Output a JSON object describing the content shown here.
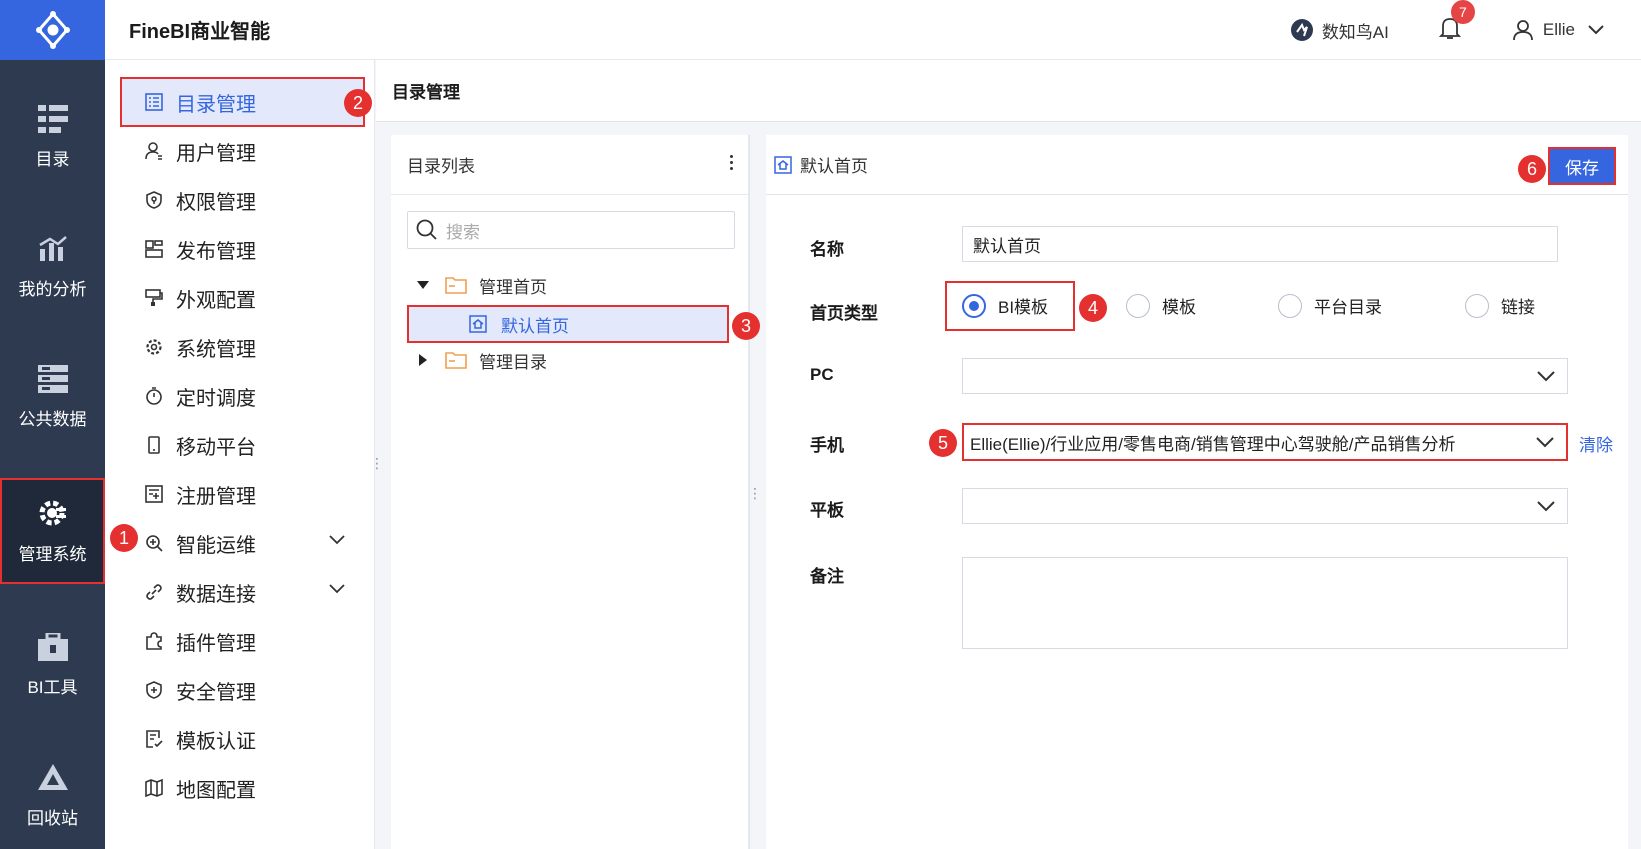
{
  "app": {
    "title": "FineBI商业智能"
  },
  "header": {
    "ai_label": "数知鸟AI",
    "notification_count": "7",
    "user_name": "Ellie"
  },
  "rail": {
    "items": [
      {
        "label": "目录",
        "icon": "catalog-icon"
      },
      {
        "label": "我的分析",
        "icon": "analysis-icon"
      },
      {
        "label": "公共数据",
        "icon": "public-data-icon"
      },
      {
        "label": "管理系统",
        "icon": "gear-icon",
        "active": true
      },
      {
        "label": "BI工具",
        "icon": "toolbox-icon"
      },
      {
        "label": "回收站",
        "icon": "recycle-icon"
      }
    ]
  },
  "submenu": {
    "items": [
      {
        "label": "目录管理",
        "icon": "list-icon",
        "active": true
      },
      {
        "label": "用户管理",
        "icon": "user-icon"
      },
      {
        "label": "权限管理",
        "icon": "permission-icon"
      },
      {
        "label": "发布管理",
        "icon": "publish-icon"
      },
      {
        "label": "外观配置",
        "icon": "appearance-icon"
      },
      {
        "label": "系统管理",
        "icon": "settings-icon"
      },
      {
        "label": "定时调度",
        "icon": "timer-icon"
      },
      {
        "label": "移动平台",
        "icon": "mobile-icon"
      },
      {
        "label": "注册管理",
        "icon": "register-icon"
      },
      {
        "label": "智能运维",
        "icon": "ops-icon",
        "expandable": true
      },
      {
        "label": "数据连接",
        "icon": "link-icon",
        "expandable": true
      },
      {
        "label": "插件管理",
        "icon": "plugin-icon"
      },
      {
        "label": "安全管理",
        "icon": "shield-icon"
      },
      {
        "label": "模板认证",
        "icon": "template-auth-icon"
      },
      {
        "label": "地图配置",
        "icon": "map-icon"
      }
    ]
  },
  "content": {
    "title": "目录管理"
  },
  "directory": {
    "title": "目录列表",
    "search_placeholder": "搜索",
    "tree": [
      {
        "label": "管理首页",
        "expanded": true
      },
      {
        "label": "默认首页",
        "selected": true
      },
      {
        "label": "管理目录",
        "expanded": false
      }
    ]
  },
  "detail": {
    "title": "默认首页",
    "save_label": "保存",
    "fields": {
      "name_label": "名称",
      "name_value": "默认首页",
      "type_label": "首页类型",
      "type_options": [
        "BI模板",
        "模板",
        "平台目录",
        "链接"
      ],
      "type_selected": "BI模板",
      "pc_label": "PC",
      "pc_value": "",
      "mobile_label": "手机",
      "mobile_value": "Ellie(Ellie)/行业应用/零售电商/销售管理中心驾驶舱/产品销售分析",
      "clear_label": "清除",
      "tablet_label": "平板",
      "tablet_value": "",
      "note_label": "备注"
    }
  },
  "steps": [
    "1",
    "2",
    "3",
    "4",
    "5",
    "6"
  ],
  "colors": {
    "accent": "#3566e0",
    "rail_bg": "#2d3a50",
    "highlight": "#e53030"
  }
}
